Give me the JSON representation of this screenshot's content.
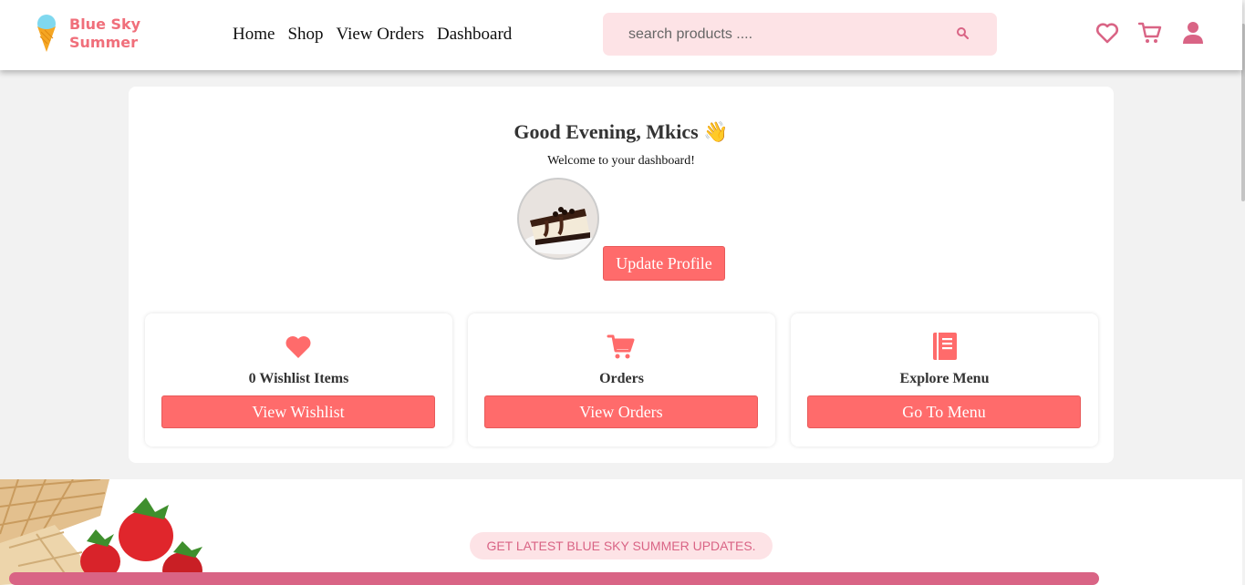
{
  "header": {
    "logo_line1": "Blue Sky",
    "logo_line2": "Summer",
    "nav": [
      "Home",
      "Shop",
      "View Orders",
      "Dashboard"
    ],
    "search_placeholder": "search products ....",
    "icons": [
      "heart-icon",
      "cart-icon",
      "user-icon"
    ]
  },
  "dashboard": {
    "greeting": "Good Evening, Mkics",
    "greeting_emoji": "👋",
    "welcome": "Welcome to your dashboard!",
    "update_profile": "Update Profile",
    "tiles": [
      {
        "icon": "heart-icon",
        "label": "0 Wishlist Items",
        "button": "View Wishlist"
      },
      {
        "icon": "cart-icon",
        "label": "Orders",
        "button": "View Orders"
      },
      {
        "icon": "menu-book-icon",
        "label": "Explore Menu",
        "button": "Go To Menu"
      }
    ]
  },
  "newsletter": {
    "pill": "GET LATEST BLUE SKY SUMMER UPDATES."
  },
  "colors": {
    "accent": "#ff6b6b",
    "brand_pink": "#d96485",
    "search_bg": "#fde3e6",
    "logo_text": "#f06f7b"
  }
}
